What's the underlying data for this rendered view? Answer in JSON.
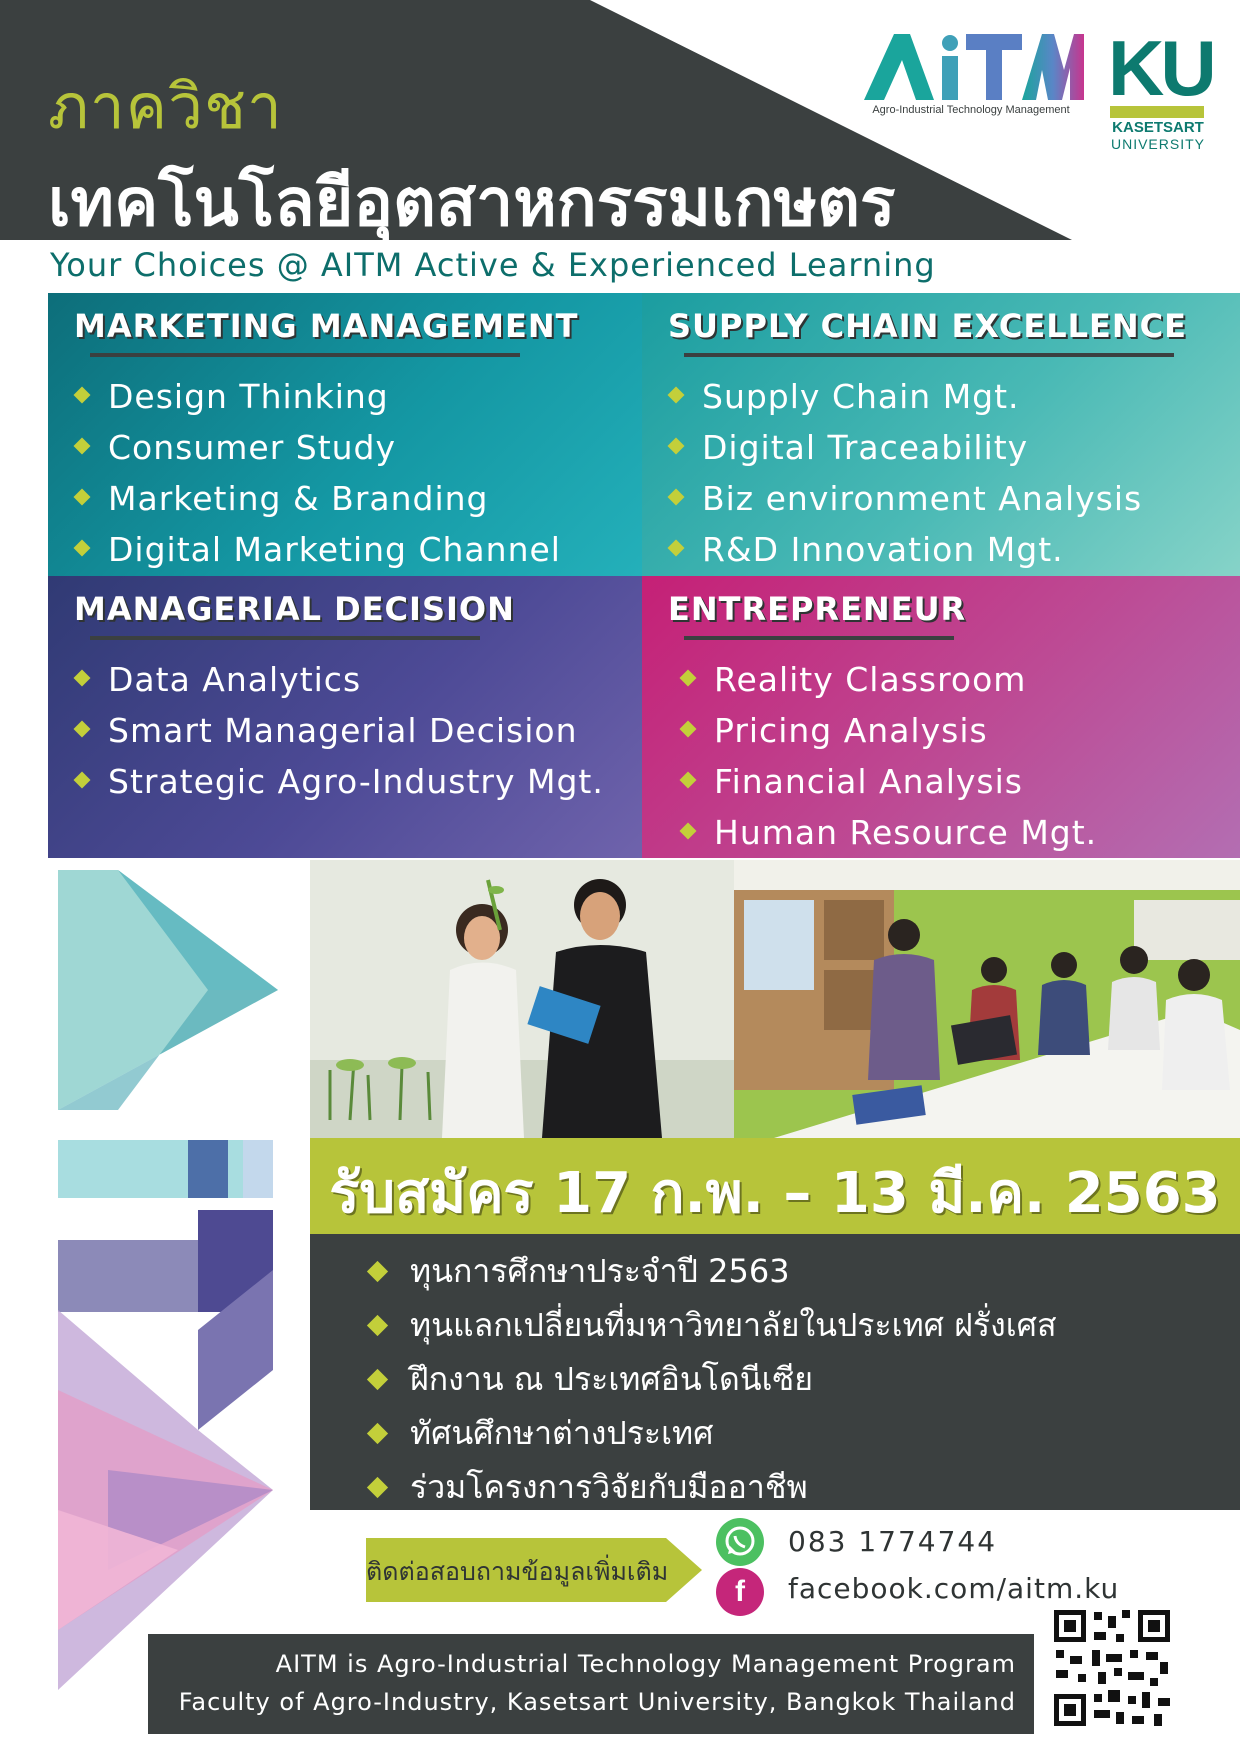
{
  "header": {
    "dept_label": "ภาควิชา",
    "dept_title": "เทคโนโลยีอุตสาหกรรมเกษตร",
    "logo_aitm": "AiTM",
    "logo_aitm_sub": "Agro-Industrial Technology Management",
    "logo_ku": "KU",
    "logo_ku_name": "KASETSART",
    "logo_ku_uni": "UNIVERSITY"
  },
  "tagline": "Your Choices @ AITM  Active & Experienced Learning",
  "tracks": [
    {
      "title": "MARKETING MANAGEMENT",
      "items": [
        "Design Thinking",
        "Consumer Study",
        "Marketing & Branding",
        "Digital Marketing Channel"
      ]
    },
    {
      "title": "SUPPLY CHAIN EXCELLENCE",
      "items": [
        "Supply Chain Mgt.",
        "Digital Traceability",
        "Biz environment Analysis",
        "R&D Innovation Mgt."
      ]
    },
    {
      "title": "MANAGERIAL DECISION",
      "items": [
        "Data Analytics",
        "Smart Managerial Decision",
        "Strategic Agro-Industry Mgt."
      ]
    },
    {
      "title": "ENTREPRENEUR",
      "items": [
        "Reality Classroom",
        "Pricing Analysis",
        "Financial Analysis",
        "Human Resource Mgt."
      ]
    }
  ],
  "registration": "รับสมัคร 17 ก.พ. – 13 มี.ค. 2563",
  "benefits": [
    "ทุนการศึกษาประจำปี 2563",
    "ทุนแลกเปลี่ยนที่มหาวิทยาลัยในประเทศ ฝรั่งเศส",
    "ฝึกงาน ณ ประเทศอินโดนีเซีย",
    "ทัศนศึกษาต่างประเทศ",
    "ร่วมโครงการวิจัยกับมืออาชีพ"
  ],
  "contact": {
    "label": "ติดต่อสอบถามข้อมูลเพิ่มเติม",
    "phone": "083 1774744",
    "facebook": "facebook.com/aitm.ku",
    "whatsapp_icon": "whatsapp-icon",
    "facebook_icon": "facebook-icon"
  },
  "footer": {
    "line1": "AITM is Agro-Industrial Technology Management Program",
    "line2": "Faculty of Agro-Industry, Kasetsart University, Bangkok Thailand"
  },
  "colors": {
    "charcoal": "#3b4040",
    "lime": "#b7c43a",
    "teal": "#0d6e7a",
    "aqua": "#49b9b5",
    "indigo": "#4d4a96",
    "magenta": "#c52076"
  }
}
